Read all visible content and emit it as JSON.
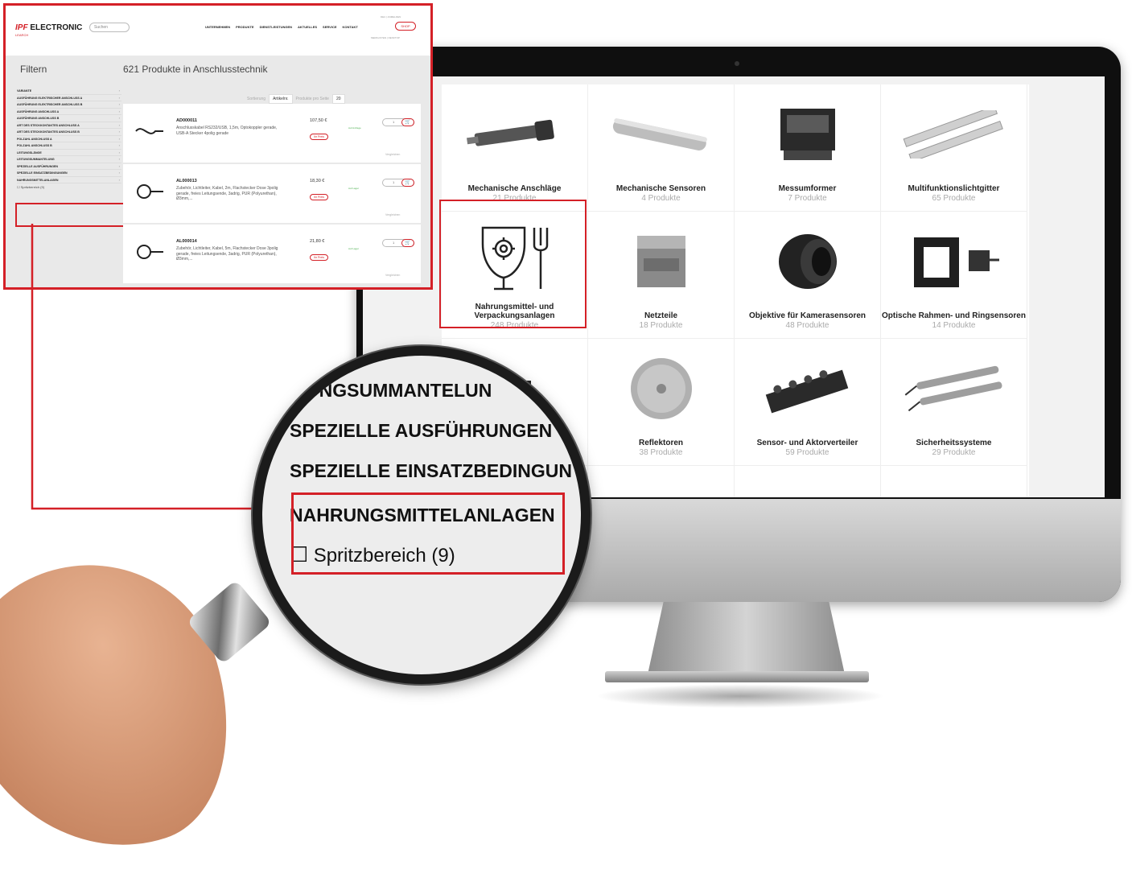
{
  "inset": {
    "logo_brand": "IPF",
    "logo_text": " ELECTRONIC",
    "logo_sub": "LEARCH",
    "search_placeholder": "Suchen",
    "nav": [
      "UNTERNEHMEN",
      "PRODUKTE",
      "DIENSTLEISTUNGEN",
      "AKTUELLES",
      "SERVICE",
      "KONTAKT"
    ],
    "shop_label": "SHOP",
    "meta_top": "DEU | ANMELDEN",
    "meta_bottom": "MERKLISTEN | DESKTOP",
    "filter_title": "Filtern",
    "products_title": "621 Produkte in Anschlusstechnik",
    "filters": [
      "VARIANTE",
      "AUSFÜHRUNG ELEKTRISCHER ANSCHLUSS A",
      "AUSFÜHRUNG ELEKTRISCHER ANSCHLUSS B",
      "AUSFÜHRUNG ANSCHLUSS A",
      "AUSFÜHRUNG ANSCHLUSS B",
      "ART DES STECKKONTAKTES ANSCHLUSS A",
      "ART DES STECKKONTAKTES ANSCHLUSS B",
      "POLZAHL ANSCHLUSS A",
      "POLZAHL ANSCHLUSS B",
      "LEITUNGSLÄNGE",
      "LEITUNGSUMMANTELUNG",
      "SPEZIELLE AUSFÜHRUNGEN",
      "SPEZIELLE EINSATZBEDINGUNGEN",
      "NAHRUNGSMITTELANLAGEN"
    ],
    "filter_option": "☐ Spritzbereich (9)",
    "sort_label": "Sortierung",
    "sort_value": "Artikelnr.",
    "per_page_label": "Produkte pro Seite",
    "per_page_value": "20",
    "products": [
      {
        "sku": "AD000011",
        "desc": "Anschlusskabel RS232/USB, 1,5m, Optokoppler gerade, USB-A Stecker 4polig gerade",
        "price": "107,50 €",
        "best_price": "Ihr Preis",
        "stock": "Auf Anfrage",
        "compare": "Vergleichen"
      },
      {
        "sku": "AL000013",
        "desc": "Zubehör, Lichtleiter, Kabel, 2m, Flachstecker Dose 3polig gerade, freies Leitungsende, 3adrig, PUR (Polyurethan), Ø3mm,...",
        "price": "18,30 €",
        "best_price": "Ihr Preis",
        "stock": "Auf Lager",
        "compare": "Vergleichen"
      },
      {
        "sku": "AL000014",
        "desc": "Zubehör, Lichtleiter, Kabel, 5m, Flachstecker Dose 3polig gerade, freies Leitungsende, 3adrig, PUR (Polyurethan), Ø3mm,...",
        "price": "21,80 €",
        "best_price": "Ihr Preis",
        "stock": "Auf Lager",
        "compare": "Vergleichen"
      }
    ]
  },
  "screen": {
    "categories": [
      {
        "name": "Mechanische Anschläge",
        "count": "21 Produkte",
        "icon": "mechanical-stop-icon"
      },
      {
        "name": "Mechanische Sensoren",
        "count": "4 Produkte",
        "icon": "mechanical-sensor-icon"
      },
      {
        "name": "Messumformer",
        "count": "7 Produkte",
        "icon": "transducer-icon"
      },
      {
        "name": "Multifunktionslichtgitter",
        "count": "65 Produkte",
        "icon": "light-grid-icon"
      },
      {
        "name": "Nahrungsmittel- und Verpackungsanlagen",
        "count": "248 Produkte",
        "icon": "food-packaging-icon"
      },
      {
        "name": "Netzteile",
        "count": "18 Produkte",
        "icon": "power-supply-icon"
      },
      {
        "name": "Objektive für Kamerasensoren",
        "count": "48 Produkte",
        "icon": "camera-lens-icon"
      },
      {
        "name": "Optische Rahmen- und Ringsensoren",
        "count": "14 Produkte",
        "icon": "frame-sensor-icon"
      },
      {
        "name": "",
        "count": "",
        "icon": "connector-icon"
      },
      {
        "name": "Reflektoren",
        "count": "38 Produkte",
        "icon": "reflector-icon"
      },
      {
        "name": "Sensor- und Aktorverteiler",
        "count": "59 Produkte",
        "icon": "distributor-icon"
      },
      {
        "name": "Sicherheitssysteme",
        "count": "29 Produkte",
        "icon": "safety-system-icon"
      }
    ]
  },
  "magnifier": {
    "lines": [
      "TUNGSUMMANTELUN",
      "SPEZIELLE AUSFÜHRUNGEN",
      "SPEZIELLE EINSATZBEDINGUN",
      "NAHRUNGSMITTELANLAGEN",
      "Spritzbereich (9)"
    ],
    "checkbox": "☐"
  },
  "colors": {
    "accent": "#d42027",
    "monitor": "#0f0f0f"
  }
}
